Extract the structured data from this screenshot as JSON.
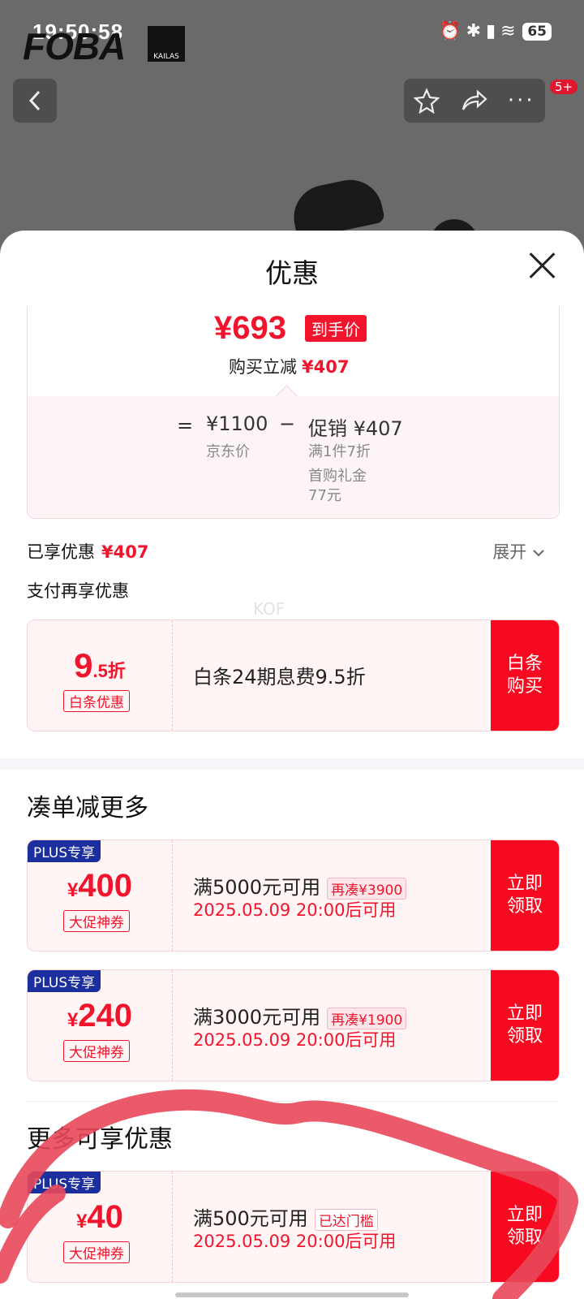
{
  "status_bar": {
    "time": "19:50:58",
    "battery": "65",
    "icons": [
      "alarm-icon",
      "bluetooth-icon",
      "signal-5g-icon",
      "wifi-icon",
      "wifi-icon"
    ]
  },
  "brand": {
    "logo_text": "FOBA",
    "sub_logo": "KAILAS"
  },
  "top_nav": {
    "badge": "5+"
  },
  "sheet": {
    "title": "优惠"
  },
  "price_summary": {
    "final_price": "¥693",
    "final_tag": "到手价",
    "reduce_label": "购买立减",
    "reduce_value": "¥407",
    "calc": {
      "equals": "=",
      "jd_price": "¥1100",
      "jd_label": "京东价",
      "minus": "−",
      "promo_label": "促销 ¥407",
      "promo_detail": "满1件7折",
      "gift_label": "首购礼金",
      "gift_value": "77元"
    }
  },
  "enjoyed": {
    "label": "已享优惠",
    "value": "¥407",
    "expand": "展开"
  },
  "pay": {
    "title": "支付再享优惠",
    "watermark": "KOF",
    "card": {
      "discount_big": "9",
      "discount_small": ".5折",
      "tag": "白条优惠",
      "desc": "白条24期息费9.5折",
      "button": "白条购买"
    }
  },
  "more_section": {
    "title": "凑单减更多"
  },
  "coupons": [
    {
      "plus": "PLUS专享",
      "yen": "¥",
      "amount": "400",
      "tag": "大促神券",
      "desc": "满5000元可用",
      "chip": "再凑¥3900",
      "time": "2025.05.09 20:00后可用",
      "button": "立即领取"
    },
    {
      "plus": "PLUS专享",
      "yen": "¥",
      "amount": "240",
      "tag": "大促神券",
      "desc": "满3000元可用",
      "chip": "再凑¥1900",
      "time": "2025.05.09 20:00后可用",
      "button": "立即领取"
    }
  ],
  "extra_section": {
    "title": "更多可享优惠"
  },
  "extra_coupon": {
    "plus": "PLUS专享",
    "yen": "¥",
    "amount": "40",
    "tag": "大促神券",
    "desc": "满500元可用",
    "chip": "已达门槛",
    "time": "2025.05.09 20:00后可用",
    "button": "立即领取"
  },
  "colors": {
    "accent_red": "#f0142c",
    "plus_blue": "#1b2f9e",
    "scribble": "#e8485a"
  }
}
